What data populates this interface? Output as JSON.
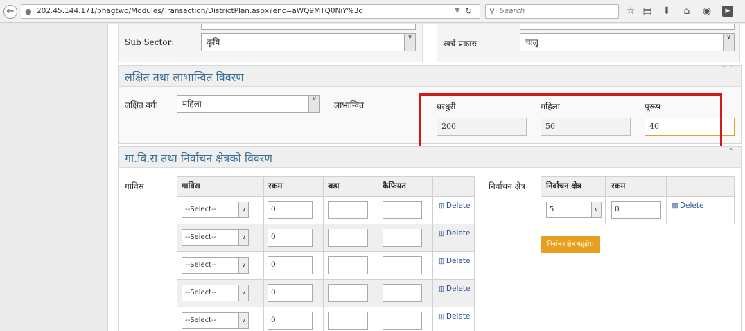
{
  "browser": {
    "url": "202.45.144.171/bhagtwo/Modules/Transaction/DistrictPlan.aspx?enc=aWQ9MTQ0NiY%3d",
    "search_placeholder": "Search",
    "icons": [
      "back-icon",
      "globe-icon",
      "dropdown-icon",
      "reload-icon",
      "search-icon",
      "star-icon",
      "reading-list-icon",
      "download-icon",
      "home-icon",
      "chat-icon",
      "youtube-icon"
    ]
  },
  "top_fields": {
    "sub_sector_label": "Sub Sector:",
    "sub_sector_value": "कृषि",
    "expense_type_label": "खर्च प्रकारः",
    "expense_type_value": "चालु"
  },
  "targeted": {
    "title": "लक्षित तथा लाभान्वित विवरण",
    "target_group_label": "लक्षित वर्गः",
    "target_group_value": "महिला",
    "beneficiary_label": "लाभान्वित",
    "household_label": "घरधुरी",
    "household_value": "200",
    "female_label": "महिला",
    "female_value": "50",
    "male_label": "पूरूष",
    "male_value": "40"
  },
  "vdc": {
    "title": "गा.वि.स तथा निर्वाचन क्षेत्रको विवरण",
    "vdc_label": "गाविस",
    "columns": [
      "गाविस",
      "रकम",
      "वडा",
      "कैफियत"
    ],
    "rows": [
      {
        "select": "--Select--",
        "amount": "0",
        "ward": "",
        "remarks": "",
        "delete": "Delete"
      },
      {
        "select": "--Select--",
        "amount": "0",
        "ward": "",
        "remarks": "",
        "delete": "Delete"
      },
      {
        "select": "--Select--",
        "amount": "0",
        "ward": "",
        "remarks": "",
        "delete": "Delete"
      },
      {
        "select": "--Select--",
        "amount": "0",
        "ward": "",
        "remarks": "",
        "delete": "Delete"
      },
      {
        "select": "--Select--",
        "amount": "0",
        "ward": "",
        "remarks": "",
        "delete": "Delete"
      }
    ],
    "constituency_label": "निर्वाचन क्षेत्र",
    "constituency_columns": [
      "निर्वाचन क्षेत्र",
      "रकम"
    ],
    "constituency_row": {
      "select": "5",
      "amount": "0",
      "delete": "Delete"
    },
    "add_button": "निर्वाचन क्षेत्र थप्नुहोस"
  },
  "colors": {
    "section_title": "#3a6e94",
    "highlight_border": "#d11a1a",
    "add_button_bg": "#e8a020",
    "delete_link": "#2a4f8f"
  }
}
